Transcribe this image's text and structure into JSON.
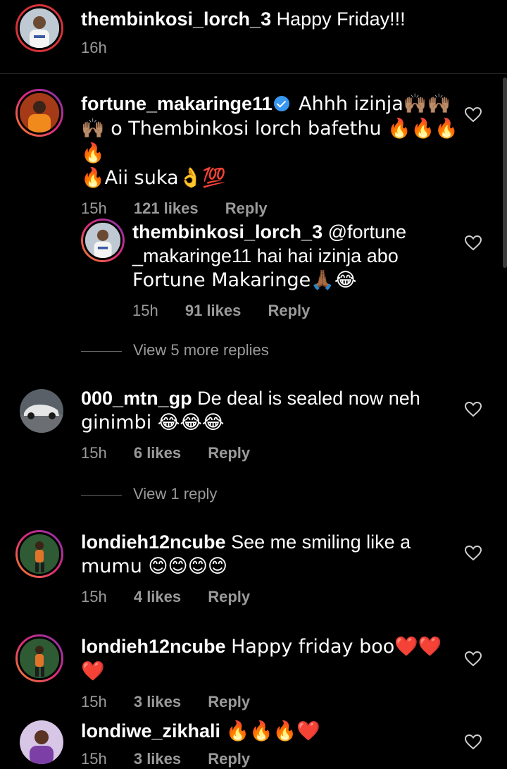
{
  "caption": {
    "username": "thembinkosi_lorch_3",
    "text": "Happy Friday!!!",
    "time": "16h"
  },
  "comments": [
    {
      "username": "fortune_makaringe11",
      "verified": true,
      "text_line1": "Ahhh izinja🙌🏽🙌🏽",
      "text_line2": "🙌🏽 o Thembinkosi lorch bafethu 🔥🔥🔥🔥",
      "text_line3": "🔥Aii suka👌💯",
      "time": "15h",
      "likes": "121 likes",
      "reply": "Reply"
    },
    {
      "username": "thembinkosi_lorch_3",
      "text_line1": "@fortune",
      "text_line2": "_makaringe11 hai hai izinja abo",
      "text_line3": "Fortune Makaringe🙏🏾😂",
      "time": "15h",
      "likes": "91 likes",
      "reply": "Reply"
    },
    {
      "username": "000_mtn_gp",
      "text_line1": "De deal is sealed now neh",
      "text_line2": "ginimbi 😂😂😂",
      "time": "15h",
      "likes": "6 likes",
      "reply": "Reply"
    },
    {
      "username": "londieh12ncube",
      "text_line1": "See me smiling like a",
      "text_line2": "mumu 😊😊😊😊",
      "time": "15h",
      "likes": "4 likes",
      "reply": "Reply"
    },
    {
      "username": "londieh12ncube",
      "text_line1": "Happy friday boo❤️❤️❤️",
      "time": "15h",
      "likes": "3 likes",
      "reply": "Reply"
    },
    {
      "username": "londiwe_zikhali",
      "text_line1": "🔥🔥🔥❤️",
      "time": "15h",
      "likes": "3 likes",
      "reply": "Reply"
    }
  ],
  "view_more_1": "View 5 more replies",
  "view_more_2": "View 1 reply",
  "colors": {
    "background": "#000000",
    "meta": "#9a9a9a",
    "verified": "#3897f0"
  },
  "icons": [
    "heart-icon",
    "verified-icon"
  ]
}
